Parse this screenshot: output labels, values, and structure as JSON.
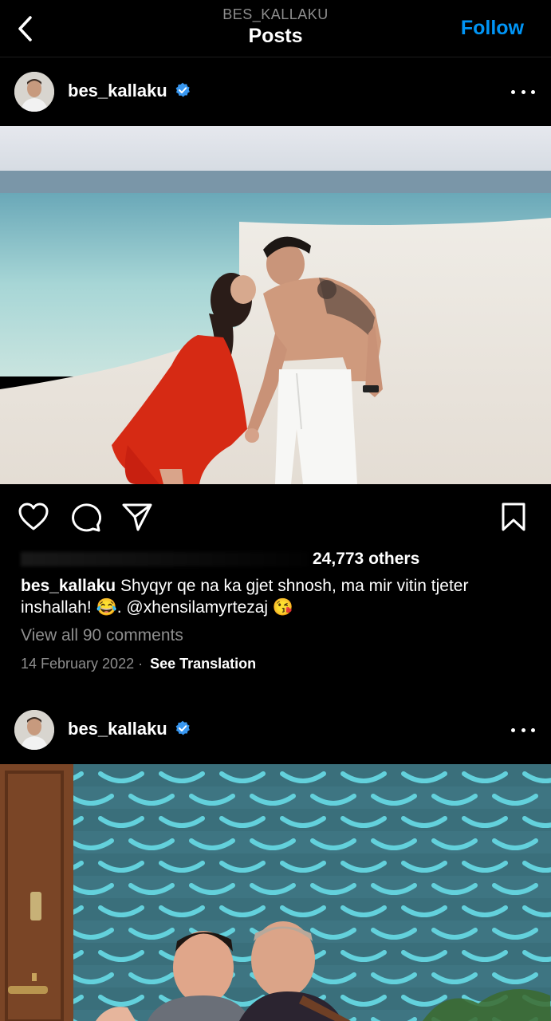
{
  "header": {
    "subtitle": "BES_KALLAKU",
    "title": "Posts",
    "follow_label": "Follow"
  },
  "posts": [
    {
      "username": "bes_kallaku",
      "image_alt": "Couple holding hands on a beach",
      "likes_text": "24,773 others",
      "caption_user": "bes_kallaku",
      "caption_text": "Shyqyr qe na ka gjet shnosh, ma mir vitin tjeter inshallah! 😂. @xhensilamyrtezaj 😘",
      "view_comments": "View all 90 comments",
      "date": "14 February 2022",
      "see_translation": "See Translation"
    },
    {
      "username": "bes_kallaku",
      "image_alt": "Two men smiling in front of a scalloped teal wall"
    }
  ],
  "icons": {
    "back": "chevron-left-icon",
    "verified": "verified-badge-icon",
    "more": "more-horizontal-icon",
    "like": "heart-icon",
    "comment": "comment-icon",
    "share": "send-icon",
    "save": "bookmark-icon"
  },
  "colors": {
    "background": "#000000",
    "accent": "#0095f6",
    "muted": "#8e8e8e",
    "verified": "#3897f0"
  }
}
